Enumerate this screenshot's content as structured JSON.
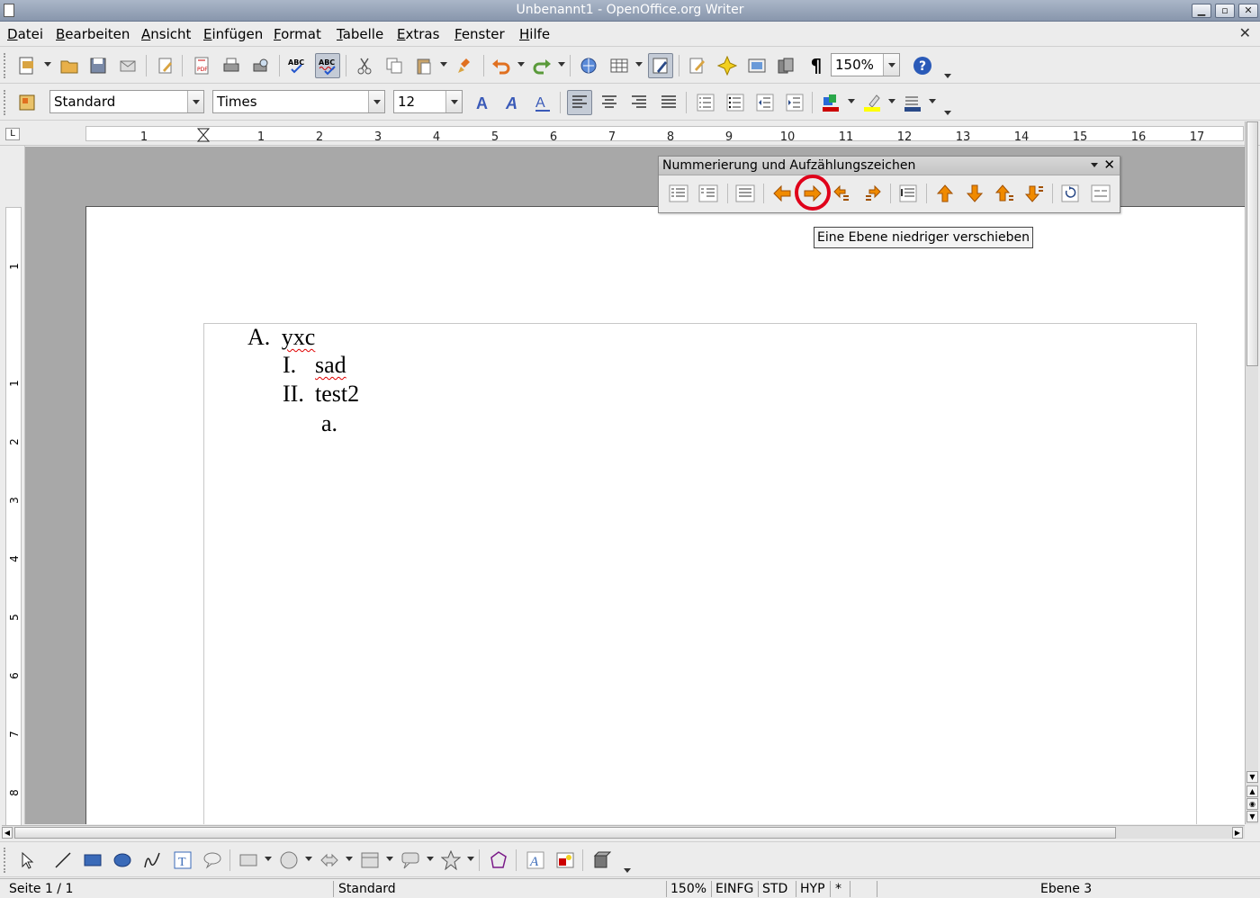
{
  "window": {
    "title": "Unbenannt1 - OpenOffice.org Writer",
    "buttons": {
      "minimize": "▁",
      "maximize": "▫",
      "close": "✕"
    }
  },
  "menubar": {
    "items": [
      {
        "label": "Datei",
        "u": "D",
        "rest": "atei"
      },
      {
        "label": "Bearbeiten",
        "u": "B",
        "rest": "earbeiten"
      },
      {
        "label": "Ansicht",
        "u": "A",
        "rest": "nsicht"
      },
      {
        "label": "Einfügen",
        "u": "E",
        "rest": "infügen"
      },
      {
        "label": "Format",
        "u": "F",
        "rest": "ormat"
      },
      {
        "label": "Tabelle",
        "u": "T",
        "rest": "abelle"
      },
      {
        "label": "Extras",
        "u": "E",
        "rest": "xtras"
      },
      {
        "label": "Fenster",
        "u": "F",
        "rest": "enster"
      },
      {
        "label": "Hilfe",
        "u": "H",
        "rest": "ilfe"
      }
    ],
    "close_doc": "✕"
  },
  "toolbar_std": {
    "zoom_value": "150%",
    "pilcrow": "¶",
    "help": "?"
  },
  "toolbar_fmt": {
    "style_value": "Standard",
    "font_value": "Times",
    "size_value": "12",
    "font_color": "#cc0000",
    "highlight_color": "#ffff00"
  },
  "ruler": {
    "labels": [
      "1",
      "1",
      "2",
      "3",
      "4",
      "5",
      "6",
      "7",
      "8",
      "9",
      "10",
      "11",
      "12",
      "13",
      "14",
      "15",
      "16",
      "17"
    ],
    "tab_selector": "L",
    "vertical_labels": [
      "1",
      "1",
      "2",
      "3",
      "4",
      "5",
      "6",
      "7",
      "8"
    ]
  },
  "document": {
    "list": [
      {
        "marker": "A.",
        "text": "yxc",
        "level": 1,
        "misspelled": true
      },
      {
        "marker": "I.",
        "text": "sad",
        "level": 2,
        "misspelled": true
      },
      {
        "marker": "II.",
        "text": "test2",
        "level": 2,
        "misspelled": false
      },
      {
        "marker": "a.",
        "text": "",
        "level": 3,
        "misspelled": false
      }
    ]
  },
  "numbering_toolbar": {
    "title": "Nummerierung und Aufzählungszeichen",
    "close": "✕",
    "highlighted_button": "Eine Ebene niedriger verschieben"
  },
  "tooltip": {
    "text": "Eine Ebene niedriger verschieben"
  },
  "statusbar": {
    "page": "Seite 1 / 1",
    "style": "Standard",
    "zoom": "150%",
    "insert_mode": "EINFG",
    "selection_mode": "STD",
    "hyperlink_mode": "HYP",
    "modified": "*",
    "level": "Ebene 3"
  },
  "colors": {
    "highlight_ring": "#e0001a",
    "arrow_orange": "#f08a00",
    "spell_underline": "#e00000"
  }
}
